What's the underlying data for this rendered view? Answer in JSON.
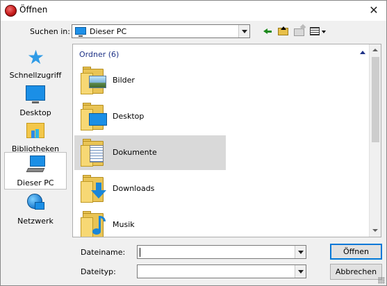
{
  "window": {
    "title": "Öffnen"
  },
  "lookin": {
    "label": "Suchen in:",
    "value": "Dieser PC"
  },
  "toolbar": {
    "back_icon": "back-arrow-icon",
    "up_icon": "folder-up-icon",
    "new_folder_icon": "new-folder-icon",
    "view_icon": "view-menu-icon"
  },
  "places": [
    {
      "label": "Schnellzugriff",
      "icon": "star-icon"
    },
    {
      "label": "Desktop",
      "icon": "desktop-icon"
    },
    {
      "label": "Bibliotheken",
      "icon": "libraries-icon"
    },
    {
      "label": "Dieser PC",
      "icon": "this-pc-icon",
      "active": true
    },
    {
      "label": "Netzwerk",
      "icon": "network-icon"
    }
  ],
  "list": {
    "group": "Ordner (6)",
    "items": [
      {
        "name": "Bilder",
        "icon": "pictures-folder-icon"
      },
      {
        "name": "Desktop",
        "icon": "desktop-folder-icon"
      },
      {
        "name": "Dokumente",
        "icon": "documents-folder-icon",
        "selected": true
      },
      {
        "name": "Downloads",
        "icon": "downloads-folder-icon"
      },
      {
        "name": "Musik",
        "icon": "music-folder-icon"
      }
    ]
  },
  "filename": {
    "label": "Dateiname:",
    "value": ""
  },
  "filetype": {
    "label": "Dateityp:",
    "value": ""
  },
  "buttons": {
    "open": "Öffnen",
    "cancel": "Abbrechen"
  },
  "colors": {
    "group_header": "#1e3287",
    "selection": "#d9d9d9",
    "default_button_border": "#0078d7"
  }
}
